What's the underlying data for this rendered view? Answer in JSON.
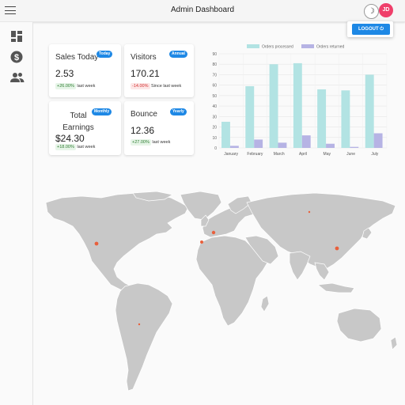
{
  "header": {
    "title": "Admin Dashboard",
    "avatar_initials": "JD",
    "theme_icon": "moon-icon"
  },
  "account_menu": {
    "logout_label": "LOGOUT",
    "logout_icon": "power-icon"
  },
  "sidebar": {
    "items": [
      {
        "icon": "dashboard-icon"
      },
      {
        "icon": "dollar-icon"
      },
      {
        "icon": "users-icon"
      }
    ]
  },
  "cards": [
    {
      "title": "Sales Today",
      "badge": "Today",
      "value": "2.53",
      "change": "+26.00%",
      "change_text": "last week",
      "trend": "up"
    },
    {
      "title": "Visitors",
      "badge": "Annual",
      "value": "170.21",
      "change": "-14.00%",
      "change_text": "Since last week",
      "trend": "down"
    },
    {
      "title": "Total Earnings",
      "badge": "Monthly",
      "value": "$24.30",
      "change": "+18.00%",
      "change_text": "last week",
      "trend": "up"
    },
    {
      "title": "Bounce",
      "badge": "Yearly",
      "value": "12.36",
      "change": "+27.00%",
      "change_text": "last week",
      "trend": "up"
    }
  ],
  "colors": {
    "accent": "#1e88e5",
    "avatar": "#ef3f6a",
    "processed": "#b2e3e3",
    "returned": "#b6b3e4",
    "map_land": "#c8c8c8",
    "map_marker": "#e8603c"
  },
  "chart_data": {
    "type": "bar",
    "categories": [
      "January",
      "February",
      "March",
      "April",
      "May",
      "June",
      "July"
    ],
    "series": [
      {
        "name": "Orders processed",
        "values": [
          25,
          59,
          80,
          81,
          56,
          55,
          70
        ]
      },
      {
        "name": "Orders returned",
        "values": [
          2,
          8,
          5,
          12,
          4,
          1,
          14
        ]
      }
    ],
    "yticks": [
      "0",
      "10",
      "20",
      "30",
      "40",
      "50",
      "60",
      "70",
      "80",
      "90"
    ],
    "ylim": [
      0,
      90
    ],
    "legend": "top",
    "grid": true
  },
  "map": {
    "type": "world-map",
    "marker_count": 6
  }
}
